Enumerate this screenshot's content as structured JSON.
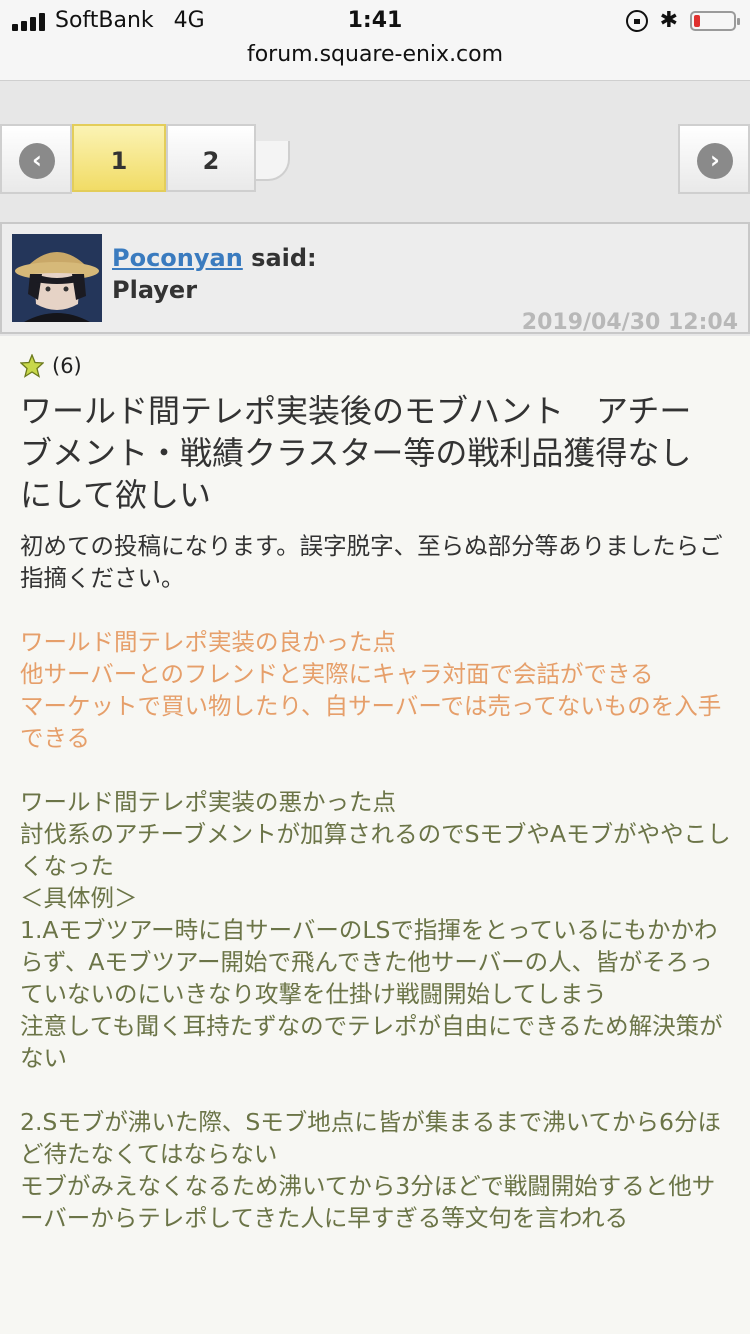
{
  "status_bar": {
    "carrier": "SoftBank",
    "network": "4G",
    "time": "1:41",
    "battery_level": 0.15,
    "url": "forum.square-enix.com"
  },
  "icons": {
    "signal": "signal-bars-icon",
    "orientation_lock": "orientation-lock-icon",
    "bluetooth": "bluetooth-icon",
    "battery": "battery-icon",
    "prev": "chevron-left-icon",
    "next": "chevron-right-icon",
    "star": "star-icon"
  },
  "colors": {
    "accent_link": "#3a7bbf",
    "current_page": "#f1dc66",
    "quote_orange": "#e69f6a",
    "body_olive": "#6b7447",
    "battery_red": "#e0312f"
  },
  "pagination": {
    "pages": [
      "1",
      "2"
    ],
    "current": "1"
  },
  "post": {
    "author": "Poconyan",
    "said": "said:",
    "role": "Player",
    "date": "2019/04/30 12:04",
    "rating": "(6)",
    "title": "ワールド間テレポ実装後のモブハント　アチーブメント・戦績クラスター等の戦利品獲得なしにして欲しい",
    "intro": "初めての投稿になります。誤字脱字、至らぬ部分等ありましたらご指摘ください。",
    "good_heading": "ワールド間テレポ実装の良かった点",
    "good_1": "他サーバーとのフレンドと実際にキャラ対面で会話ができる",
    "good_2": "マーケットで買い物したり、自サーバーでは売ってないものを入手できる",
    "bad_heading": "ワールド間テレポ実装の悪かった点",
    "bad_1": "討伐系のアチーブメントが加算されるのでSモブやAモブがややこしくなった",
    "bad_example": "＜具体例＞",
    "bad_2": "1.Aモブツアー時に自サーバーのLSで指揮をとっているにもかかわらず、Aモブツアー開始で飛んできた他サーバーの人、皆がそろっていないのにいきなり攻撃を仕掛け戦闘開始してしまう",
    "bad_3": "注意しても聞く耳持たずなのでテレポが自由にできるため解決策がない",
    "bad_4": "2.Sモブが沸いた際、Sモブ地点に皆が集まるまで沸いてから6分ほど待たなくてはならない",
    "bad_5": "モブがみえなくなるため沸いてから3分ほどで戦闘開始すると他サーバーからテレポしてきた人に早すぎる等文句を言われる"
  }
}
